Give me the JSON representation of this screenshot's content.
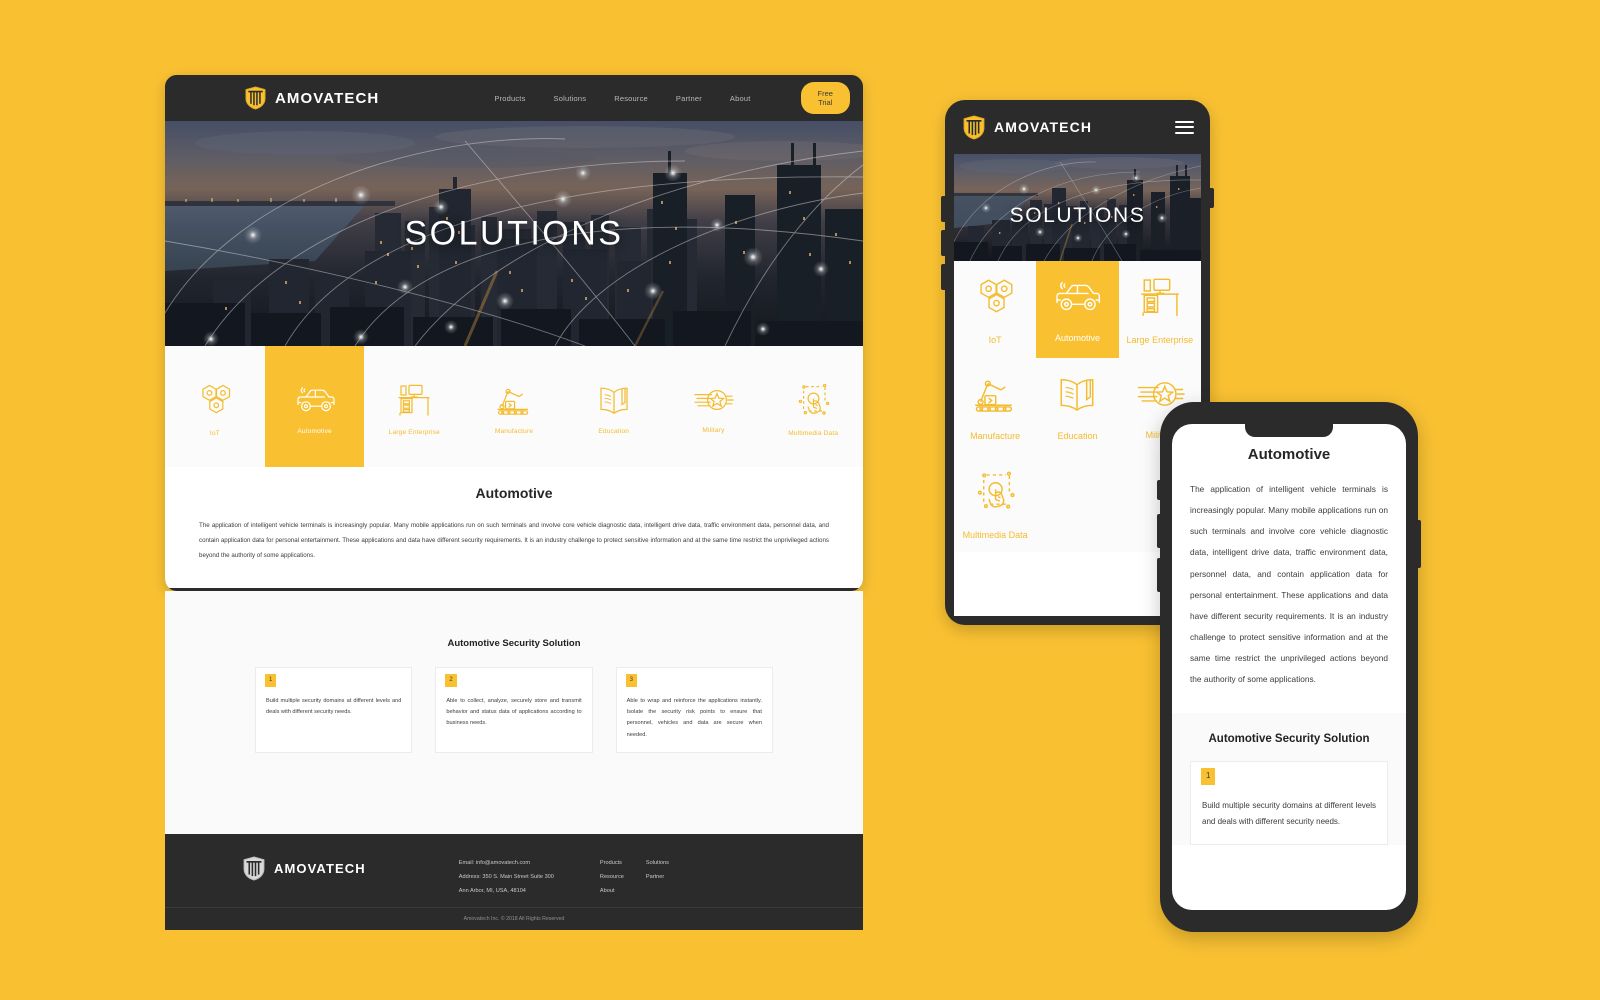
{
  "background_color": "#f9c132",
  "brand": {
    "name": "AMOVATECH",
    "logo_icon": "shield-icon",
    "accent_color": "#f9c132",
    "dark_color": "#2b2b2b"
  },
  "desktop": {
    "nav": [
      {
        "label": "Products"
      },
      {
        "label": "Solutions"
      },
      {
        "label": "Resource"
      },
      {
        "label": "Partner"
      },
      {
        "label": "About"
      }
    ],
    "cta_label": "Free Trial",
    "hero": {
      "title": "SOLUTIONS"
    },
    "categories": [
      {
        "label": "IoT",
        "icon": "hexagon-network-icon",
        "active": false
      },
      {
        "label": "Automotive",
        "icon": "car-icon",
        "active": true
      },
      {
        "label": "Large Enterprise",
        "icon": "office-desk-icon",
        "active": false
      },
      {
        "label": "Manufacture",
        "icon": "robot-arm-icon",
        "active": false
      },
      {
        "label": "Education",
        "icon": "open-book-icon",
        "active": false
      },
      {
        "label": "Military",
        "icon": "star-wings-badge-icon",
        "active": false
      },
      {
        "label": "Multimedia Data",
        "icon": "touch-hand-icon",
        "active": false
      }
    ],
    "article": {
      "title": "Automotive",
      "body": "The application of intelligent vehicle terminals is increasingly popular. Many mobile applications run on such terminals and involve core vehicle diagnostic data, intelligent drive data, traffic environment data, personnel data, and contain application data for personal entertainment. These applications and data have different security requirements. It is an industry challenge to protect sensitive information and at the same time restrict the unprivileged actions beyond the authority of some applications."
    },
    "solutions": {
      "title": "Automotive Security Solution",
      "cards": [
        {
          "number": "1",
          "text": "Build multiple security domains at different levels and deals with different security needs."
        },
        {
          "number": "2",
          "text": "Able to collect, analyze, securely store and transmit behavior and status data of applications according to business needs."
        },
        {
          "number": "3",
          "text": "Able to wrap and reinforce the applications instantly. Isolate the security risk points to ensure that personnel, vehicles and data are secure when needed."
        }
      ]
    },
    "footer": {
      "contact": [
        "Email: info@amovatech.com",
        "Address: 350 S. Main Street Suite 300",
        "Ann Arbor, MI, USA, 48104"
      ],
      "link_columns": [
        {
          "links": [
            "Products",
            "Resource",
            "About"
          ]
        },
        {
          "links": [
            "Solutions",
            "Partner"
          ]
        }
      ],
      "copyright": "Amovatech Inc. © 2018 All Rights Reserved"
    }
  },
  "tablet": {
    "menu_icon": "hamburger-menu-icon",
    "hero": {
      "title": "SOLUTIONS"
    },
    "categories": [
      {
        "label": "IoT",
        "icon": "hexagon-network-icon",
        "active": false
      },
      {
        "label": "Automotive",
        "icon": "car-icon",
        "active": true
      },
      {
        "label": "Large Enterprise",
        "icon": "office-desk-icon",
        "active": false
      },
      {
        "label": "Manufacture",
        "icon": "robot-arm-icon",
        "active": false
      },
      {
        "label": "Education",
        "icon": "open-book-icon",
        "active": false
      },
      {
        "label": "Military",
        "icon": "star-wings-badge-icon",
        "active": false
      },
      {
        "label": "Multimedia Data",
        "icon": "touch-hand-icon",
        "active": false
      }
    ]
  },
  "phone": {
    "article": {
      "title": "Automotive",
      "body": "The application of intelligent vehicle terminals is increasingly popular. Many mobile applications run on such terminals and involve core vehicle diagnostic data, intelligent drive data, traffic environment data, personnel data, and contain application data for personal entertainment. These applications and data have different security requirements. It is an industry challenge to protect sensitive information and at the same time restrict the unprivileged actions beyond the authority of some applications."
    },
    "solutions": {
      "title": "Automotive Security Solution",
      "cards": [
        {
          "number": "1",
          "text": "Build multiple security domains at different levels and deals with different security needs."
        }
      ]
    }
  }
}
